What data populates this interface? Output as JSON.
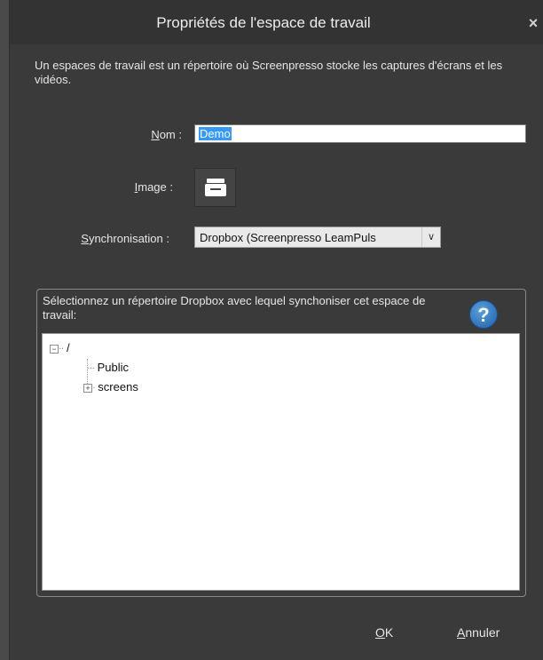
{
  "window": {
    "title": "Propriétés de l'espace de travail",
    "close_glyph": "×"
  },
  "description": "Un espaces de travail est un répertoire où Screenpresso stocke les captures d'écrans et les vidéos.",
  "form": {
    "nom_label_accel": "N",
    "nom_label_rest": "om :",
    "nom_value": "Demo",
    "image_label_accel": "I",
    "image_label_rest": "mage :",
    "image_icon": "printer-icon",
    "sync_label_accel": "S",
    "sync_label_rest": "ynchronisation :",
    "sync_value": "Dropbox (Screenpresso LeamPuls",
    "sync_arrow": "∨"
  },
  "dropbox": {
    "instruction": "Sélectionnez un répertoire Dropbox avec lequel synchoniser cet espace de travail:",
    "help_glyph": "?",
    "tree": {
      "root": "/",
      "root_expander": "−",
      "children": [
        {
          "label": "Public"
        },
        {
          "label": "screens",
          "expander": "+"
        }
      ]
    }
  },
  "buttons": {
    "ok_accel": "O",
    "ok_rest": "K",
    "cancel_accel": "A",
    "cancel_rest": "nnuler"
  }
}
